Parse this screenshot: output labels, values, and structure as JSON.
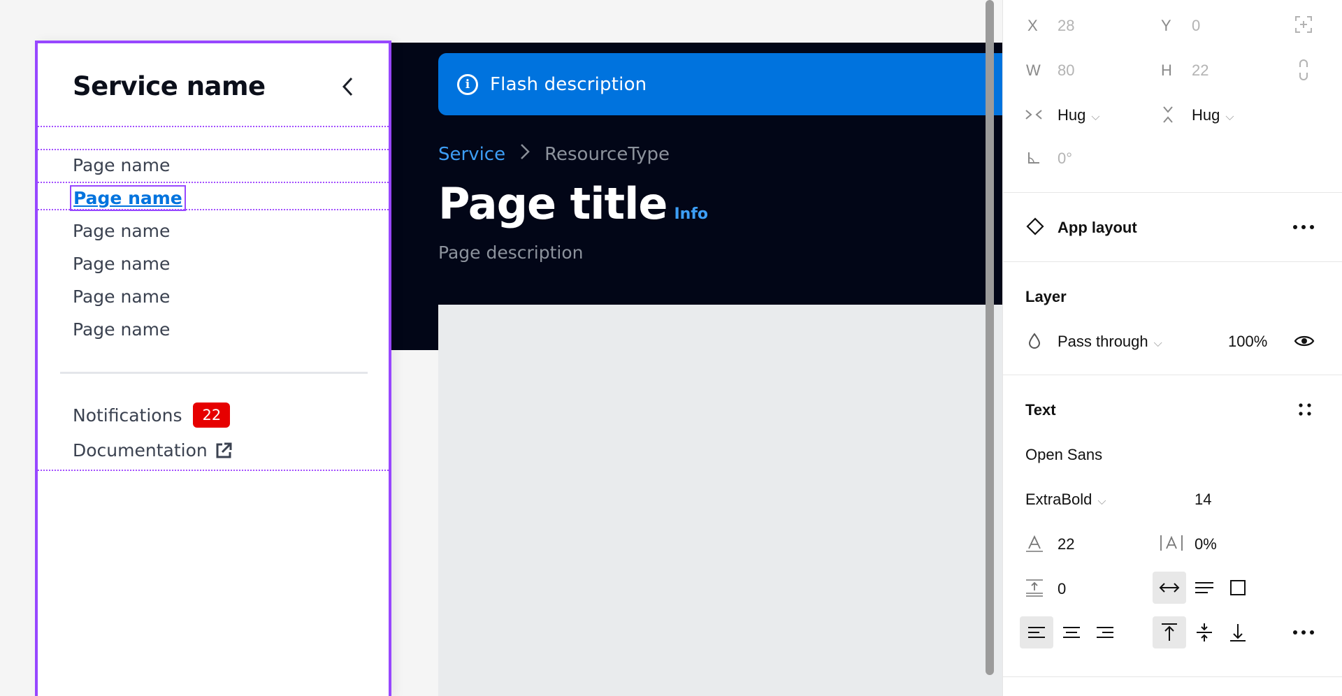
{
  "canvas": {
    "flash": {
      "text": "Flash description",
      "icon": "info-circle-icon"
    },
    "breadcrumb": {
      "link": "Service",
      "current": "ResourceType"
    },
    "page_title": "Page title",
    "info_link": "Info",
    "page_description": "Page description"
  },
  "sidenav": {
    "service_name": "Service name",
    "items": [
      {
        "label": "Page name",
        "active": false
      },
      {
        "label": "Page name",
        "active": true
      },
      {
        "label": "Page name",
        "active": false
      },
      {
        "label": "Page name",
        "active": false
      },
      {
        "label": "Page name",
        "active": false
      },
      {
        "label": "Page name",
        "active": false
      }
    ],
    "notifications": {
      "label": "Notifications",
      "count": "22"
    },
    "documentation": {
      "label": "Documentation"
    }
  },
  "panel": {
    "position": {
      "x_label": "X",
      "x_value": "28",
      "y_label": "Y",
      "y_value": "0"
    },
    "size": {
      "w_label": "W",
      "w_value": "80",
      "h_label": "H",
      "h_value": "22"
    },
    "resizing": {
      "horizontal": "Hug",
      "vertical": "Hug"
    },
    "rotation": "0°",
    "component": {
      "name": "App layout"
    },
    "layer": {
      "title": "Layer",
      "blend": "Pass through",
      "opacity": "100%"
    },
    "text": {
      "title": "Text",
      "font_family": "Open Sans",
      "font_weight": "ExtraBold",
      "font_size": "14",
      "line_height": "22",
      "letter_spacing": "0%",
      "paragraph_spacing": "0"
    }
  },
  "colors": {
    "accent": "#0073de",
    "frame_outline": "#9747ff",
    "dark_header": "#020617",
    "badge": "#e60000",
    "link": "#3d9ef5"
  }
}
